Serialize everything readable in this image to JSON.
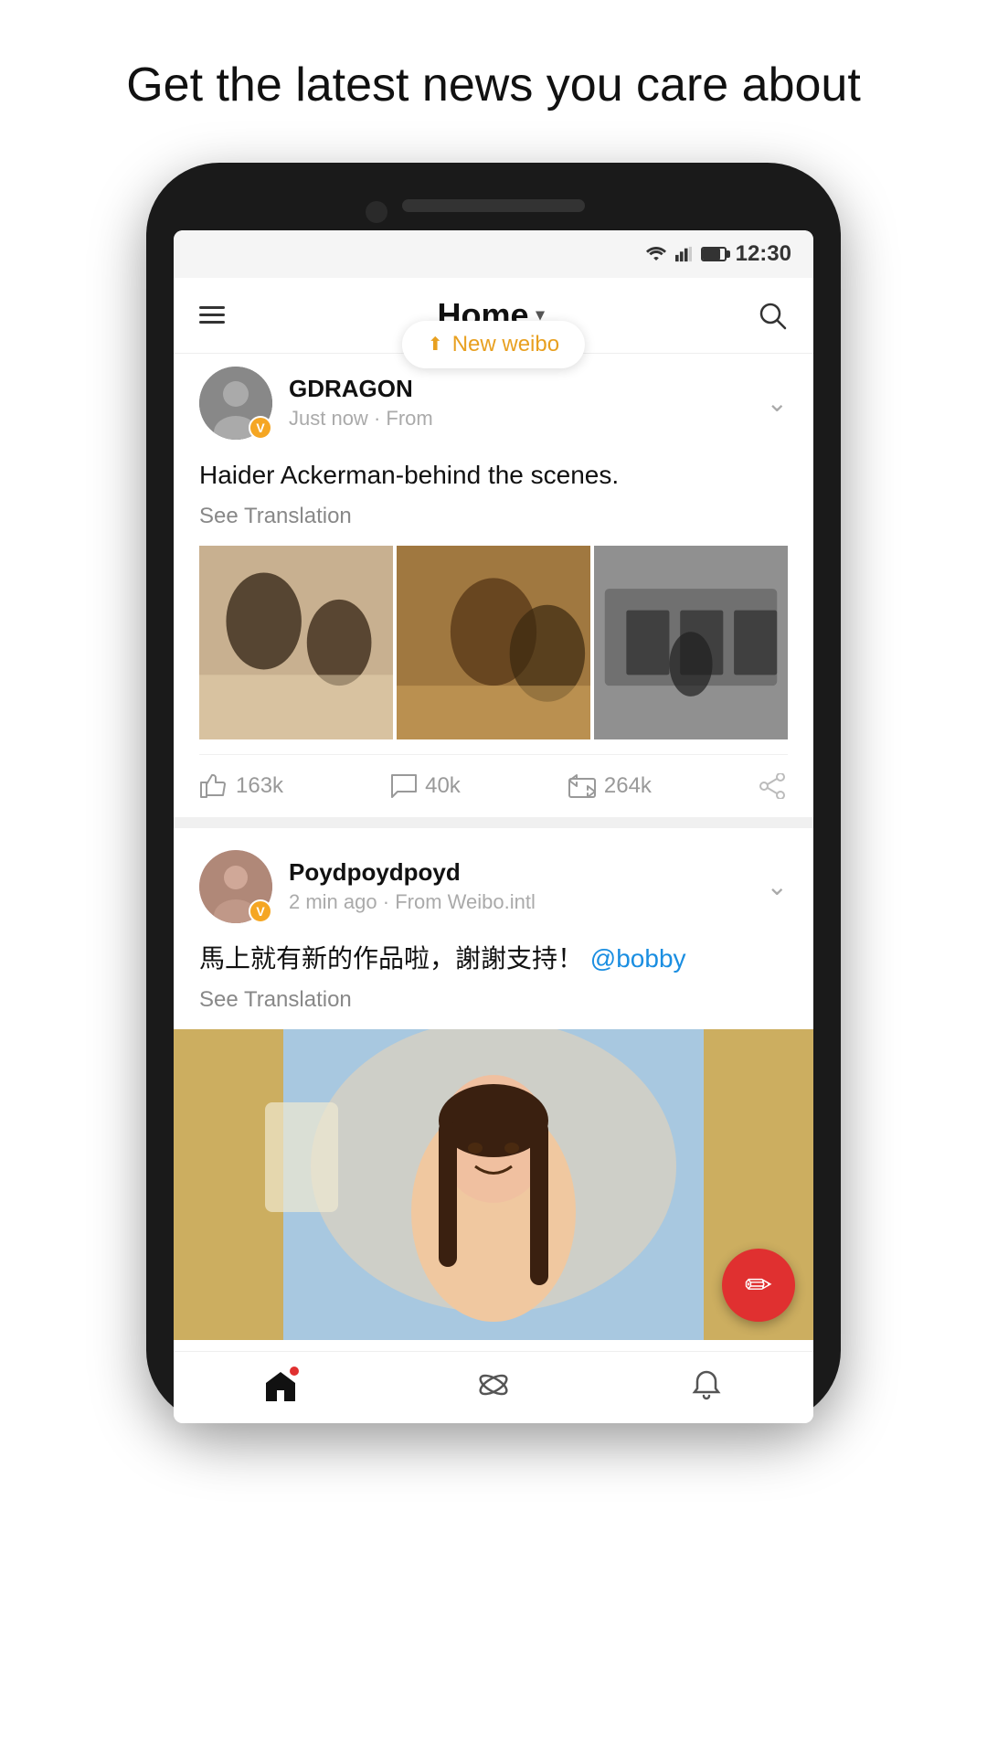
{
  "page": {
    "headline": "Get the latest news you care about"
  },
  "status_bar": {
    "time": "12:30"
  },
  "header": {
    "title": "Home",
    "dropdown_label": "Home ▾"
  },
  "toast": {
    "label": "New weibo"
  },
  "posts": [
    {
      "id": "post-1",
      "username": "GDRAGON",
      "time": "Just now",
      "source": "From",
      "content": "Haider Ackerman-behind the scenes.",
      "see_translation": "See Translation",
      "likes": "163k",
      "comments": "40k",
      "reposts": "264k"
    },
    {
      "id": "post-2",
      "username": "Poydpoydpoyd",
      "time": "2 min ago",
      "source": "From Weibo.intl",
      "content": "馬上就有新的作品啦，謝謝支持！",
      "mention": "@bobby",
      "see_translation": "See Translation"
    }
  ],
  "nav": {
    "home_label": "home",
    "discover_label": "discover",
    "notifications_label": "notifications"
  },
  "fab": {
    "icon": "✏"
  }
}
